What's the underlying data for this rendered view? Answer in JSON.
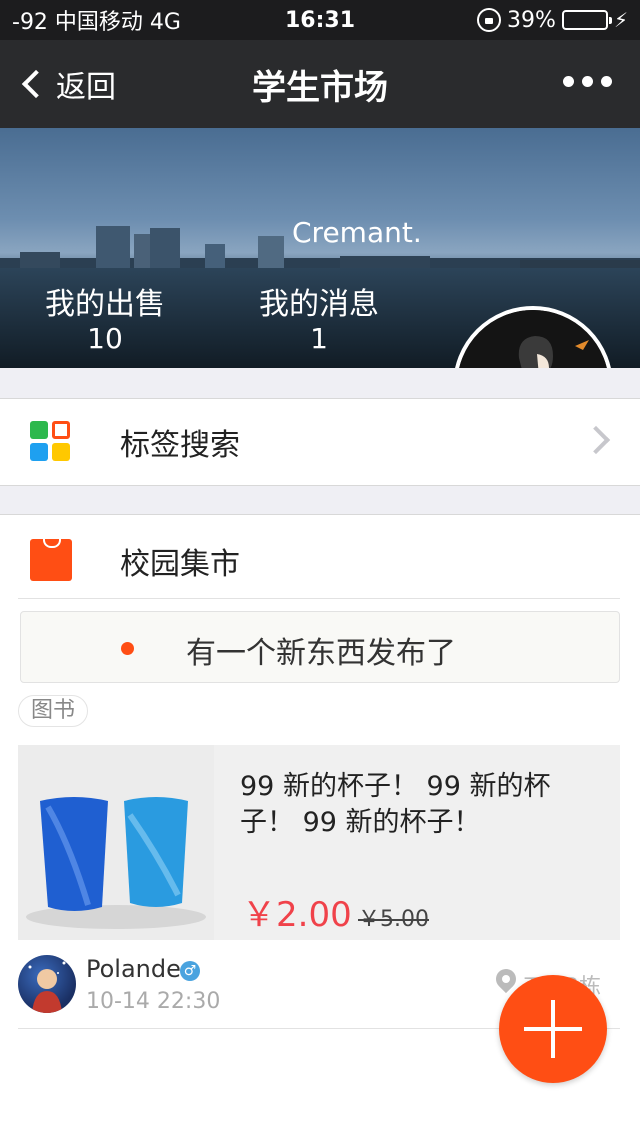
{
  "status_bar": {
    "carrier": "-92 中国移动 4G",
    "time": "16:31",
    "battery": "39%",
    "battery_level": 0.39
  },
  "nav": {
    "back_label": "返回",
    "title": "学生市场"
  },
  "profile": {
    "username": "Cremant.",
    "sell_label": "我的出售",
    "sell_count": "10",
    "message_label": "我的消息",
    "message_count": "1"
  },
  "tag_search": {
    "label": "标签搜索",
    "colors": [
      "#2db84d",
      "#ff4e14",
      "#1ea0f0",
      "#ffc800"
    ]
  },
  "market": {
    "title": "校园集市",
    "notice": "有一个新东西发布了",
    "tag": "图书",
    "item": {
      "title": "99 新的杯子！ 99 新的杯子！ 99 新的杯子！",
      "price": "￥2.00",
      "old_price": "￥5.00"
    },
    "seller": {
      "name": "Polande",
      "gender_icon": "male-icon",
      "time": "10-14 22:30",
      "location": "五...3栋"
    }
  },
  "colors": {
    "accent": "#ff4e14",
    "price": "#f0424a"
  }
}
